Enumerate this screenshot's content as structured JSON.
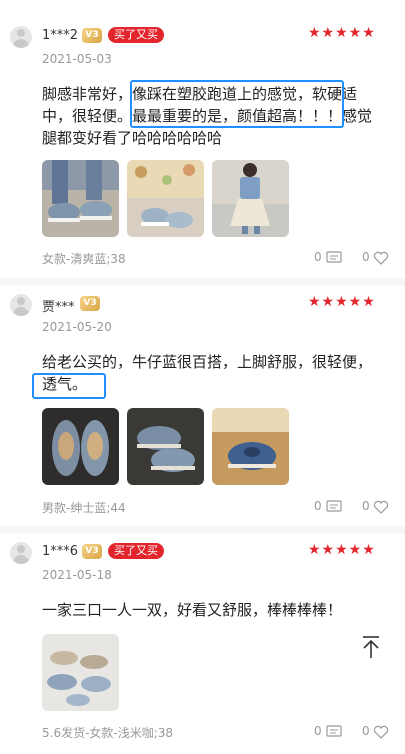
{
  "reviews": [
    {
      "username": "1***2",
      "vip_label": "V3",
      "badge": "买了又买",
      "stars": "★★★★★",
      "date": "2021-05-03",
      "text_lines": [
        "脚感非常好，像踩在塑胶跑道上的感觉，软硬适",
        "中，很轻便。最最重要的是，颜值超高！！！感觉",
        "腿都变好看了哈哈哈哈哈哈"
      ],
      "variant": "女款-清爽蓝;38",
      "comment_count": "0",
      "like_count": "0"
    },
    {
      "username": "贾***",
      "vip_label": "V3",
      "badge": "",
      "stars": "★★★★★",
      "date": "2021-05-20",
      "text_lines": [
        "给老公买的，牛仔蓝很百搭，上脚舒服，很轻便，",
        "透气。"
      ],
      "variant": "男款-绅士蓝;44",
      "comment_count": "0",
      "like_count": "0"
    },
    {
      "username": "1***6",
      "vip_label": "V3",
      "badge": "买了又买",
      "stars": "★★★★★",
      "date": "2021-05-18",
      "text_lines": [
        "一家三口一人一双，好看又舒服，棒棒棒棒！"
      ],
      "variant": "5.6发货-女款-浅米咖;38",
      "comment_count": "0",
      "like_count": "0"
    }
  ],
  "colors": {
    "accent_red": "#e3262d",
    "highlight_blue": "#1e90ff",
    "meta_gray": "#999999"
  }
}
